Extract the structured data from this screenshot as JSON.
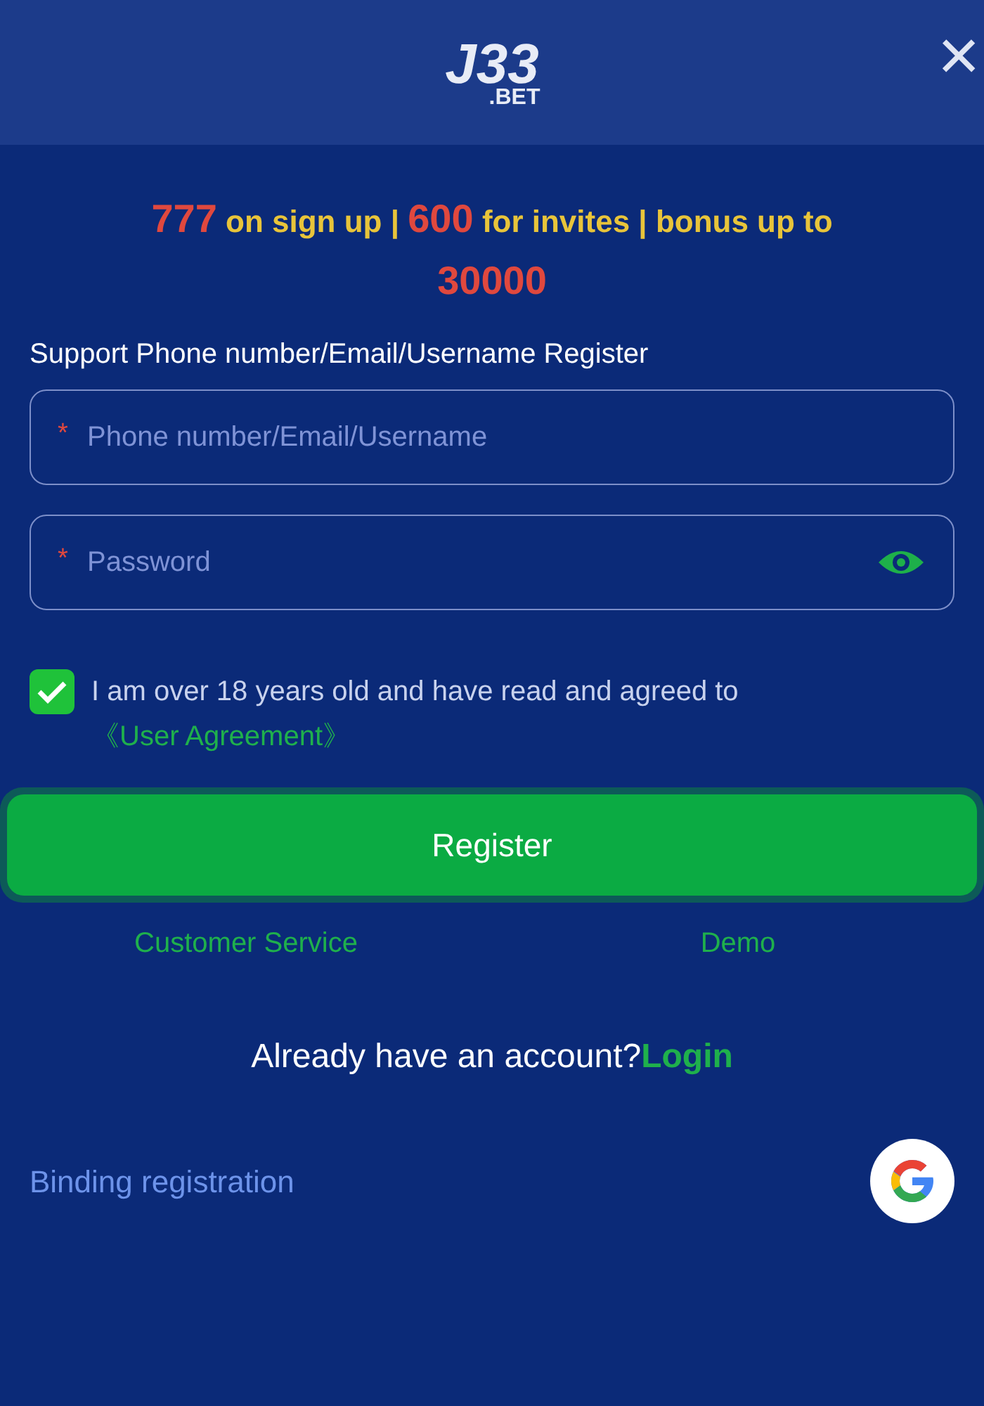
{
  "header": {
    "logo": {
      "main": "J33",
      "suffix": ".BET"
    },
    "close": "×"
  },
  "promo": [
    {
      "kind": "highlight",
      "text": "777"
    },
    {
      "kind": "plain",
      "text": " on sign up | "
    },
    {
      "kind": "highlight",
      "text": "600"
    },
    {
      "kind": "plain",
      "text": " for invites | bonus up to "
    },
    {
      "kind": "highlight",
      "text": "30000"
    }
  ],
  "form": {
    "title": "Support Phone number/Email/Username Register",
    "fields": [
      {
        "kind": "text",
        "required_mark": "*",
        "placeholder": "Phone number/Email/Username"
      },
      {
        "kind": "password",
        "required_mark": "*",
        "placeholder": "Password"
      }
    ],
    "agreement": {
      "checked": true,
      "text": "I am over 18 years old and have read and agreed to",
      "link": "《User Agreement》"
    },
    "submit": "Register"
  },
  "links": [
    "Customer Service",
    "Demo"
  ],
  "login_prompt": {
    "text": "Already have an account?",
    "link": "Login"
  },
  "binding": "Binding registration"
}
